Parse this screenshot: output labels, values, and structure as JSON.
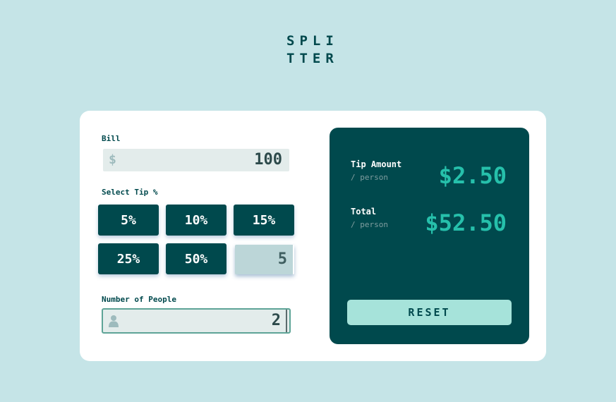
{
  "app": {
    "logo": "SPLITTER"
  },
  "bill": {
    "label": "Bill",
    "currency_symbol": "$",
    "value": "100"
  },
  "tip": {
    "label": "Select Tip %",
    "options": [
      "5%",
      "10%",
      "15%",
      "25%",
      "50%"
    ],
    "custom_value": "5"
  },
  "people": {
    "label": "Number of People",
    "value": "2",
    "icon": "person-icon"
  },
  "results": {
    "tip_amount": {
      "title": "Tip Amount",
      "subtitle": "/ person",
      "value": "$2.50"
    },
    "total": {
      "title": "Total",
      "subtitle": "/ person",
      "value": "$52.50"
    }
  },
  "reset_label": "RESET",
  "colors": {
    "background": "#c5e4e7",
    "dark_cyan": "#00494d",
    "strong_cyan": "#26c0ab",
    "light_cyan": "#a6e3da"
  }
}
